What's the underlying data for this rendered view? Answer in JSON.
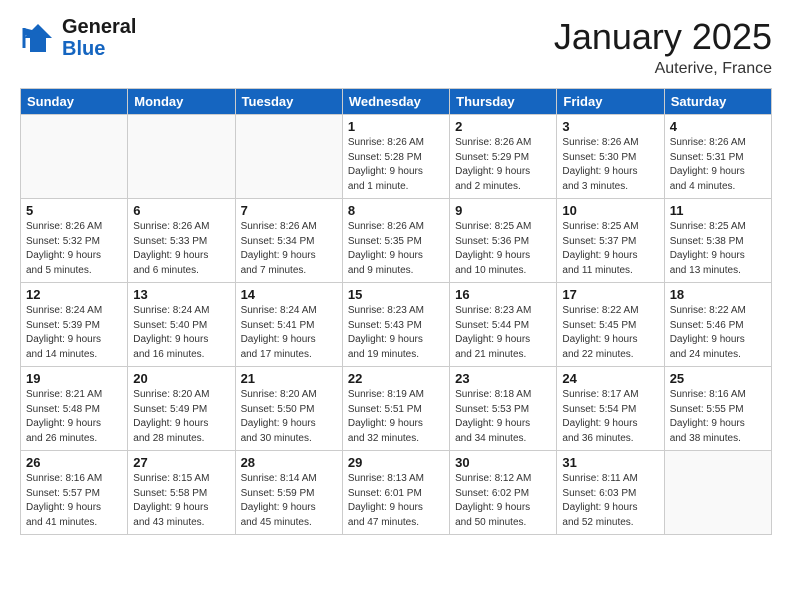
{
  "header": {
    "logo_line1": "General",
    "logo_line2": "Blue",
    "cal_title": "January 2025",
    "cal_subtitle": "Auterive, France"
  },
  "weekdays": [
    "Sunday",
    "Monday",
    "Tuesday",
    "Wednesday",
    "Thursday",
    "Friday",
    "Saturday"
  ],
  "weeks": [
    [
      {
        "day": "",
        "info": ""
      },
      {
        "day": "",
        "info": ""
      },
      {
        "day": "",
        "info": ""
      },
      {
        "day": "1",
        "info": "Sunrise: 8:26 AM\nSunset: 5:28 PM\nDaylight: 9 hours\nand 1 minute."
      },
      {
        "day": "2",
        "info": "Sunrise: 8:26 AM\nSunset: 5:29 PM\nDaylight: 9 hours\nand 2 minutes."
      },
      {
        "day": "3",
        "info": "Sunrise: 8:26 AM\nSunset: 5:30 PM\nDaylight: 9 hours\nand 3 minutes."
      },
      {
        "day": "4",
        "info": "Sunrise: 8:26 AM\nSunset: 5:31 PM\nDaylight: 9 hours\nand 4 minutes."
      }
    ],
    [
      {
        "day": "5",
        "info": "Sunrise: 8:26 AM\nSunset: 5:32 PM\nDaylight: 9 hours\nand 5 minutes."
      },
      {
        "day": "6",
        "info": "Sunrise: 8:26 AM\nSunset: 5:33 PM\nDaylight: 9 hours\nand 6 minutes."
      },
      {
        "day": "7",
        "info": "Sunrise: 8:26 AM\nSunset: 5:34 PM\nDaylight: 9 hours\nand 7 minutes."
      },
      {
        "day": "8",
        "info": "Sunrise: 8:26 AM\nSunset: 5:35 PM\nDaylight: 9 hours\nand 9 minutes."
      },
      {
        "day": "9",
        "info": "Sunrise: 8:25 AM\nSunset: 5:36 PM\nDaylight: 9 hours\nand 10 minutes."
      },
      {
        "day": "10",
        "info": "Sunrise: 8:25 AM\nSunset: 5:37 PM\nDaylight: 9 hours\nand 11 minutes."
      },
      {
        "day": "11",
        "info": "Sunrise: 8:25 AM\nSunset: 5:38 PM\nDaylight: 9 hours\nand 13 minutes."
      }
    ],
    [
      {
        "day": "12",
        "info": "Sunrise: 8:24 AM\nSunset: 5:39 PM\nDaylight: 9 hours\nand 14 minutes."
      },
      {
        "day": "13",
        "info": "Sunrise: 8:24 AM\nSunset: 5:40 PM\nDaylight: 9 hours\nand 16 minutes."
      },
      {
        "day": "14",
        "info": "Sunrise: 8:24 AM\nSunset: 5:41 PM\nDaylight: 9 hours\nand 17 minutes."
      },
      {
        "day": "15",
        "info": "Sunrise: 8:23 AM\nSunset: 5:43 PM\nDaylight: 9 hours\nand 19 minutes."
      },
      {
        "day": "16",
        "info": "Sunrise: 8:23 AM\nSunset: 5:44 PM\nDaylight: 9 hours\nand 21 minutes."
      },
      {
        "day": "17",
        "info": "Sunrise: 8:22 AM\nSunset: 5:45 PM\nDaylight: 9 hours\nand 22 minutes."
      },
      {
        "day": "18",
        "info": "Sunrise: 8:22 AM\nSunset: 5:46 PM\nDaylight: 9 hours\nand 24 minutes."
      }
    ],
    [
      {
        "day": "19",
        "info": "Sunrise: 8:21 AM\nSunset: 5:48 PM\nDaylight: 9 hours\nand 26 minutes."
      },
      {
        "day": "20",
        "info": "Sunrise: 8:20 AM\nSunset: 5:49 PM\nDaylight: 9 hours\nand 28 minutes."
      },
      {
        "day": "21",
        "info": "Sunrise: 8:20 AM\nSunset: 5:50 PM\nDaylight: 9 hours\nand 30 minutes."
      },
      {
        "day": "22",
        "info": "Sunrise: 8:19 AM\nSunset: 5:51 PM\nDaylight: 9 hours\nand 32 minutes."
      },
      {
        "day": "23",
        "info": "Sunrise: 8:18 AM\nSunset: 5:53 PM\nDaylight: 9 hours\nand 34 minutes."
      },
      {
        "day": "24",
        "info": "Sunrise: 8:17 AM\nSunset: 5:54 PM\nDaylight: 9 hours\nand 36 minutes."
      },
      {
        "day": "25",
        "info": "Sunrise: 8:16 AM\nSunset: 5:55 PM\nDaylight: 9 hours\nand 38 minutes."
      }
    ],
    [
      {
        "day": "26",
        "info": "Sunrise: 8:16 AM\nSunset: 5:57 PM\nDaylight: 9 hours\nand 41 minutes."
      },
      {
        "day": "27",
        "info": "Sunrise: 8:15 AM\nSunset: 5:58 PM\nDaylight: 9 hours\nand 43 minutes."
      },
      {
        "day": "28",
        "info": "Sunrise: 8:14 AM\nSunset: 5:59 PM\nDaylight: 9 hours\nand 45 minutes."
      },
      {
        "day": "29",
        "info": "Sunrise: 8:13 AM\nSunset: 6:01 PM\nDaylight: 9 hours\nand 47 minutes."
      },
      {
        "day": "30",
        "info": "Sunrise: 8:12 AM\nSunset: 6:02 PM\nDaylight: 9 hours\nand 50 minutes."
      },
      {
        "day": "31",
        "info": "Sunrise: 8:11 AM\nSunset: 6:03 PM\nDaylight: 9 hours\nand 52 minutes."
      },
      {
        "day": "",
        "info": ""
      }
    ]
  ]
}
